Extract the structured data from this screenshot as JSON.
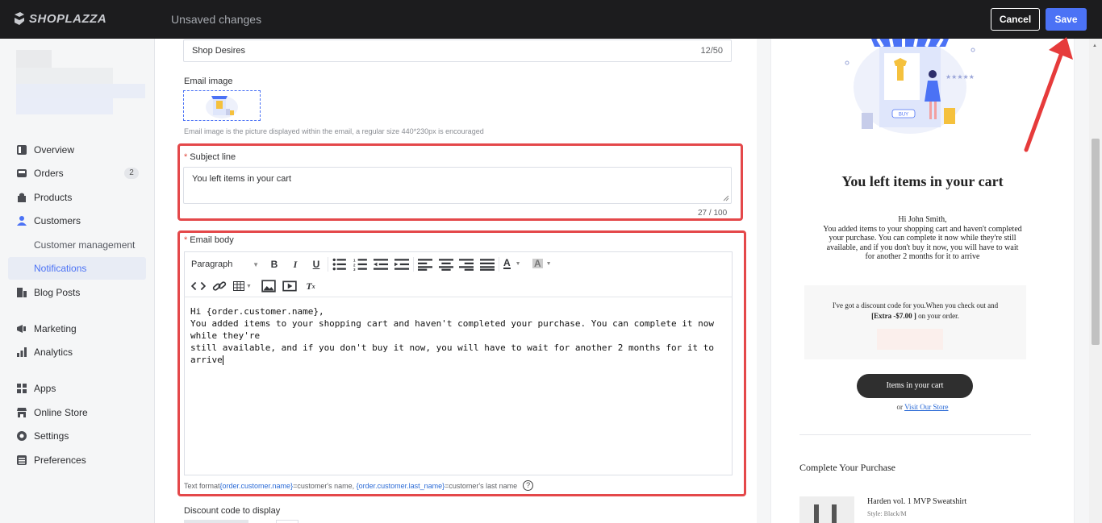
{
  "topbar": {
    "logo_text": "SHOPLAZZA",
    "status": "Unsaved changes",
    "cancel_label": "Cancel",
    "save_label": "Save"
  },
  "sidebar": {
    "items": [
      {
        "label": "Overview",
        "icon": "overview-icon"
      },
      {
        "label": "Orders",
        "icon": "orders-icon",
        "badge": "2"
      },
      {
        "label": "Products",
        "icon": "products-icon"
      },
      {
        "label": "Customers",
        "icon": "customers-icon"
      },
      {
        "label": "Blog Posts",
        "icon": "blog-icon"
      },
      {
        "label": "Marketing",
        "icon": "marketing-icon"
      },
      {
        "label": "Analytics",
        "icon": "analytics-icon"
      },
      {
        "label": "Apps",
        "icon": "apps-icon"
      },
      {
        "label": "Online Store",
        "icon": "store-icon"
      },
      {
        "label": "Settings",
        "icon": "settings-icon"
      },
      {
        "label": "Preferences",
        "icon": "preferences-icon"
      }
    ],
    "sub_items": [
      {
        "label": "Customer management"
      },
      {
        "label": "Notifications"
      }
    ]
  },
  "form": {
    "sender_name_value": "Shop Desires",
    "sender_name_count": "12/50",
    "email_image_label": "Email image",
    "email_image_hint": "Email image is the picture displayed within the email, a regular size 440*230px is encouraged",
    "subject_label": "Subject line",
    "subject_value": "You left items in your cart",
    "subject_count": "27 / 100",
    "body_label": "Email body",
    "paragraph_select": "Paragraph",
    "body_line1": "Hi {order.customer.name},",
    "body_line2": "You added items to your shopping cart and haven't completed your purchase. You can complete it now while they're",
    "body_line3": "still available, and if you don't buy it now, you will have to wait for another 2 months for it to arrive",
    "format_prefix": "Text format",
    "format_var1": "{order.customer.name}",
    "format_mid": "=customer's name, ",
    "format_var2": "{order.customer.last_name}",
    "format_suffix": "=customer's last name",
    "discount_label": "Discount code to display"
  },
  "preview": {
    "buy_label": "BUY",
    "heading": "You left items in your cart",
    "greeting": "Hi John Smith,",
    "body_1": "You added items to your shopping cart and haven't completed",
    "body_2": "your purchase. You can complete it now while they're still",
    "body_3": "available, and if you don't buy it now, you will have to wait",
    "body_4": "for another 2 months for it to arrive",
    "discount_1": "I've got a discount code for you.When you check out and",
    "discount_code": "[Extra -$7.00 ]",
    "discount_2": " on your order.",
    "cart_button": "Items in your cart",
    "or_text": "or ",
    "visit_link": "Visit Our Store",
    "complete_heading": "Complete Your Purchase",
    "product_name": "Harden vol. 1 MVP Sweatshirt",
    "product_style": "Style: Black/M"
  },
  "colors": {
    "accent": "#4b72f5",
    "highlight": "#e4484a",
    "topbar": "#1c1c1e",
    "link": "#2a6ad6"
  }
}
